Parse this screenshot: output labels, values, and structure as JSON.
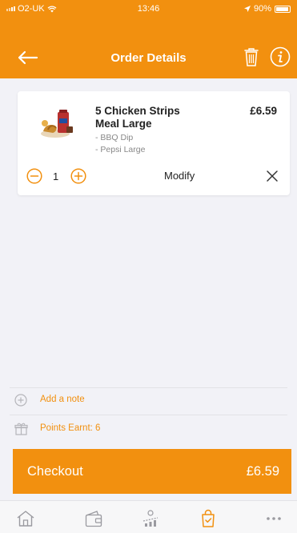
{
  "status_bar": {
    "carrier": "O2-UK",
    "time": "13:46",
    "battery": "90%"
  },
  "header": {
    "title": "Order Details",
    "icons": [
      "back-arrow-icon",
      "trash-icon",
      "info-icon"
    ]
  },
  "order_item": {
    "name_line1": "5 Chicken Strips",
    "name_line2": "Meal Large",
    "price": "£6.59",
    "options": [
      "- BBQ Dip",
      "- Pepsi Large"
    ],
    "quantity": "1",
    "modify_label": "Modify"
  },
  "note": {
    "label": "Add a note"
  },
  "points": {
    "label": "Points Earnt: 6"
  },
  "checkout": {
    "label": "Checkout",
    "total": "£6.59"
  },
  "tabs": [
    "home-icon",
    "wallet-icon",
    "rewards-icon",
    "basket-icon",
    "more-icon"
  ],
  "colors": {
    "accent": "#f2900f",
    "background": "#f2f2f7"
  }
}
